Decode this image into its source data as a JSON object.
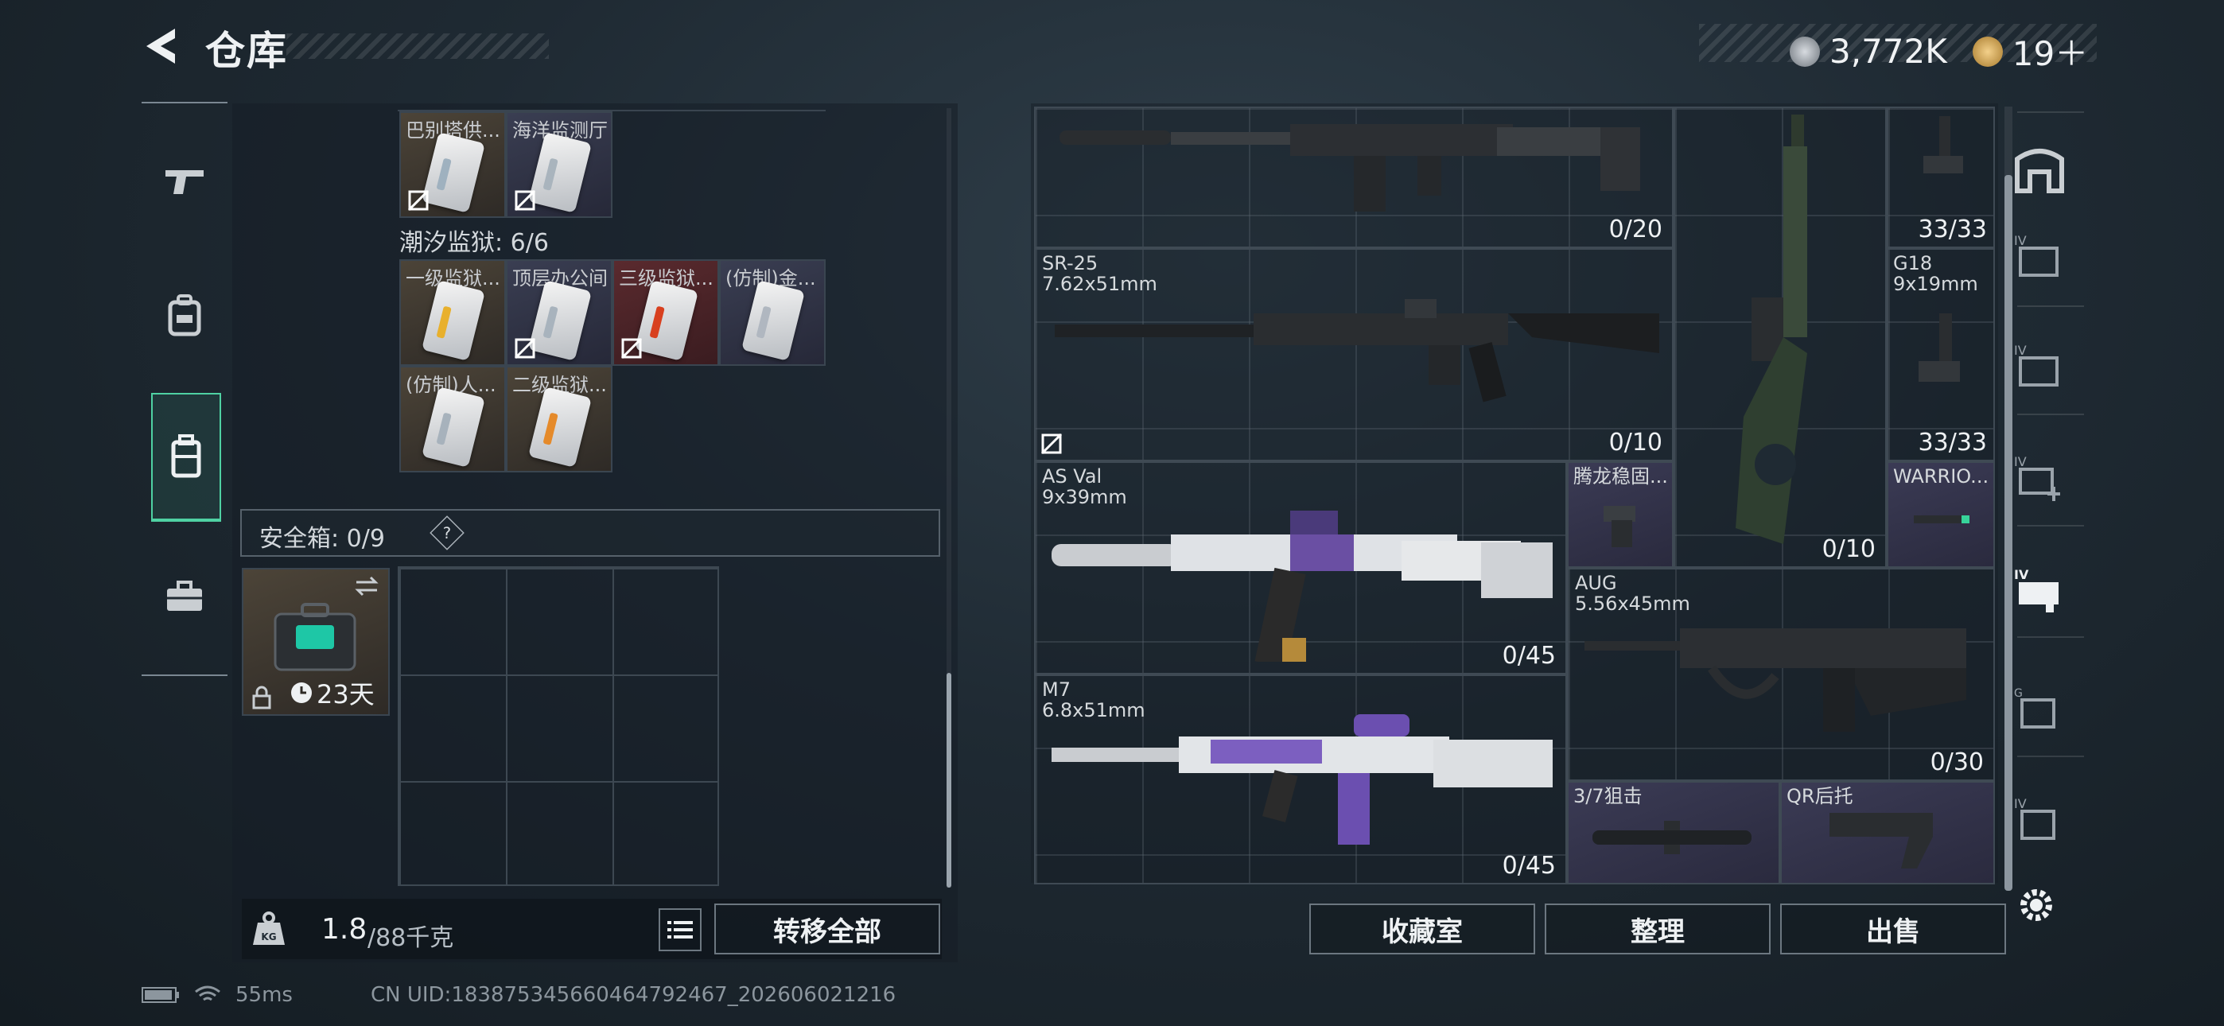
{
  "header": {
    "title": "仓库",
    "currency1": "3,772K",
    "currency2": "19＋"
  },
  "left": {
    "top_items": [
      {
        "name": "巴别塔供..."
      },
      {
        "name": "海洋监测厅"
      }
    ],
    "section1": "潮汐监狱: 6/6",
    "prison_items": [
      {
        "name": "一级监狱..."
      },
      {
        "name": "顶层办公间"
      },
      {
        "name": "三级监狱..."
      },
      {
        "name": "(仿制)金..."
      },
      {
        "name": "(仿制)人..."
      },
      {
        "name": "二级监狱..."
      }
    ],
    "safebox_label": "安全箱: 0/9",
    "safebox_help": "?",
    "case_timer": "23天",
    "weight_value": "1.8",
    "weight_unit": "/88千克",
    "transfer_all": "转移全部"
  },
  "right": {
    "weapons": [
      {
        "name": "",
        "caliber": "",
        "count": "0/20"
      },
      {
        "name": "SR-25",
        "caliber": "7.62x51mm",
        "count": "0/10"
      },
      {
        "name": "AS Val",
        "caliber": "9x39mm",
        "count": "0/45"
      },
      {
        "name": "M7",
        "caliber": "6.8x51mm",
        "count": "0/45"
      },
      {
        "name": "AUG",
        "caliber": "5.56x45mm",
        "count": "0/30"
      },
      {
        "name": "G18",
        "caliber": "9x19mm",
        "count": "33/33"
      },
      {
        "name": "",
        "caliber": "",
        "count": "33/33"
      },
      {
        "name": "",
        "caliber": "",
        "count": "0/10"
      }
    ],
    "accessories": [
      {
        "name": "腾龙稳固..."
      },
      {
        "name": "WARRIO..."
      },
      {
        "name": "3/7狙击"
      },
      {
        "name": "QR后托"
      }
    ],
    "buttons": {
      "collection": "收藏室",
      "organize": "整理",
      "sell": "出售"
    }
  },
  "status": {
    "ping": "55ms",
    "uid": "CN UID:18387534566046479246​7_202606021216"
  },
  "colors": {
    "accent": "#4fd1a3",
    "gold_rarity": "#4c4438",
    "blue_rarity": "#3a3e52",
    "red_rarity": "#5a2a2e",
    "purple_rarity": "#3b3b55"
  }
}
